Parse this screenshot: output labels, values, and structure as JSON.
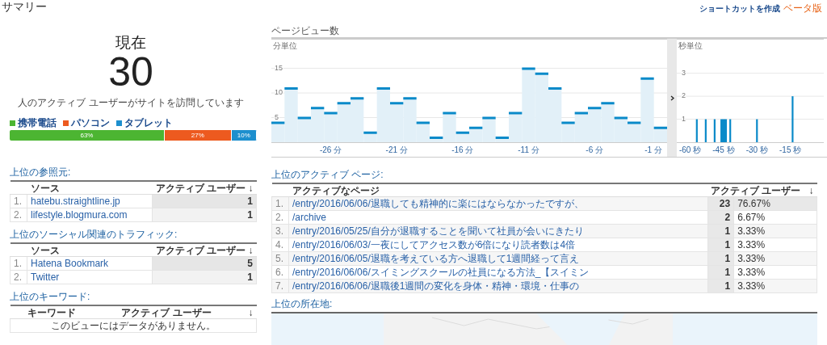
{
  "title": "サマリー",
  "shortcut": {
    "label": "ショートカットを作成",
    "badge": "ベータ版"
  },
  "now": {
    "heading": "現在",
    "count": "30",
    "caption": "人のアクティブ ユーザーがサイトを訪問しています"
  },
  "devices": [
    {
      "label": "携帯電話",
      "share": "63%",
      "color": "#4cb532"
    },
    {
      "label": "パソコン",
      "share": "27%",
      "color": "#ed5a1f"
    },
    {
      "label": "タブレット",
      "share": "10%",
      "color": "#1d8fce"
    }
  ],
  "pageviews": {
    "title": "ページビュー数",
    "minutes": {
      "label": "分単位",
      "chart_data": {
        "type": "bar",
        "grid": true,
        "yticks": [
          5,
          10,
          15
        ],
        "ylim": [
          0,
          21
        ],
        "xlim": [
          -30.5,
          -0.5
        ],
        "xticks": [
          {
            "value": -26,
            "label": "-26 分"
          },
          {
            "value": -21,
            "label": "-21 分"
          },
          {
            "value": -16,
            "label": "-16 分"
          },
          {
            "value": -11,
            "label": "-11 分"
          },
          {
            "value": -6,
            "label": "-6 分"
          },
          {
            "value": -1,
            "label": "-1 分"
          }
        ],
        "x": [
          -30,
          -29,
          -28,
          -27,
          -26,
          -25,
          -24,
          -23,
          -22,
          -21,
          -20,
          -19,
          -18,
          -17,
          -16,
          -15,
          -14,
          -13,
          -12,
          -11,
          -10,
          -9,
          -8,
          -7,
          -6,
          -5,
          -4,
          -3,
          -2,
          -1
        ],
        "values": [
          4,
          11,
          5,
          7,
          6,
          8,
          9,
          2,
          11,
          8,
          9,
          4,
          1,
          6,
          2,
          3,
          5,
          1,
          6,
          15,
          14,
          11,
          4,
          6,
          7,
          8,
          5,
          4,
          13,
          3
        ]
      }
    },
    "seconds": {
      "label": "秒単位",
      "chart_data": {
        "type": "bar",
        "grid": true,
        "yticks": [
          1,
          2,
          3
        ],
        "ylim": [
          0,
          4.5
        ],
        "xlim": [
          -66,
          0
        ],
        "xticks": [
          {
            "value": -60,
            "label": "-60 秒"
          },
          {
            "value": -45,
            "label": "-45 秒"
          },
          {
            "value": -30,
            "label": "-30 秒"
          },
          {
            "value": -15,
            "label": "-15 秒"
          }
        ],
        "x": [
          -57,
          -53,
          -49,
          -46,
          -45.3,
          -44.6,
          -43.9,
          -42,
          -30,
          -14
        ],
        "values": [
          1,
          1,
          1,
          1,
          1,
          1,
          1,
          1,
          1,
          2
        ]
      }
    }
  },
  "referrers": {
    "title": "上位の参照元:",
    "columns": [
      "ソース",
      "アクティブ ユーザー ↓"
    ],
    "rows": [
      {
        "index": "1.",
        "name": "hatebu.straightline.jp",
        "users": "1"
      },
      {
        "index": "2.",
        "name": "lifestyle.blogmura.com",
        "users": "1"
      }
    ]
  },
  "social": {
    "title": "上位のソーシャル関連のトラフィック:",
    "columns": [
      "ソース",
      "アクティブ ユーザー ↓"
    ],
    "rows": [
      {
        "index": "1.",
        "name": "Hatena Bookmark",
        "users": "5"
      },
      {
        "index": "2.",
        "name": "Twitter",
        "users": "1"
      }
    ]
  },
  "keywords": {
    "title": "上位のキーワード:",
    "columns": [
      "キーワード",
      "アクティブ ユーザー",
      "↓"
    ],
    "empty": "このビューにはデータがありません。"
  },
  "active_pages": {
    "title": "上位のアクティブ ページ:",
    "columns": [
      "アクティブなページ",
      "アクティブ ユーザー",
      "↓"
    ],
    "rows": [
      {
        "index": "1.",
        "page": "/entry/2016/06/06/退職しても精神的に楽にはならなかったですが、",
        "users": "23",
        "percent": "76.67%"
      },
      {
        "index": "2.",
        "page": "/archive",
        "users": "2",
        "percent": "6.67%"
      },
      {
        "index": "3.",
        "page": "/entry/2016/05/25/自分が退職することを聞いて社員が会いにきたり",
        "users": "1",
        "percent": "3.33%"
      },
      {
        "index": "4.",
        "page": "/entry/2016/06/03/一夜にしてアクセス数が6倍になり読者数は4倍",
        "users": "1",
        "percent": "3.33%"
      },
      {
        "index": "5.",
        "page": "/entry/2016/06/05/退職を考えている方へ退職して1週間経って言え",
        "users": "1",
        "percent": "3.33%"
      },
      {
        "index": "6.",
        "page": "/entry/2016/06/06/スイミングスクールの社員になる方法_【スイミン",
        "users": "1",
        "percent": "3.33%"
      },
      {
        "index": "7.",
        "page": "/entry/2016/06/06/退職後1週間の変化を身体・精神・環境・仕事の",
        "users": "1",
        "percent": "3.33%"
      }
    ]
  },
  "locations": {
    "title": "上位の所在地:"
  }
}
